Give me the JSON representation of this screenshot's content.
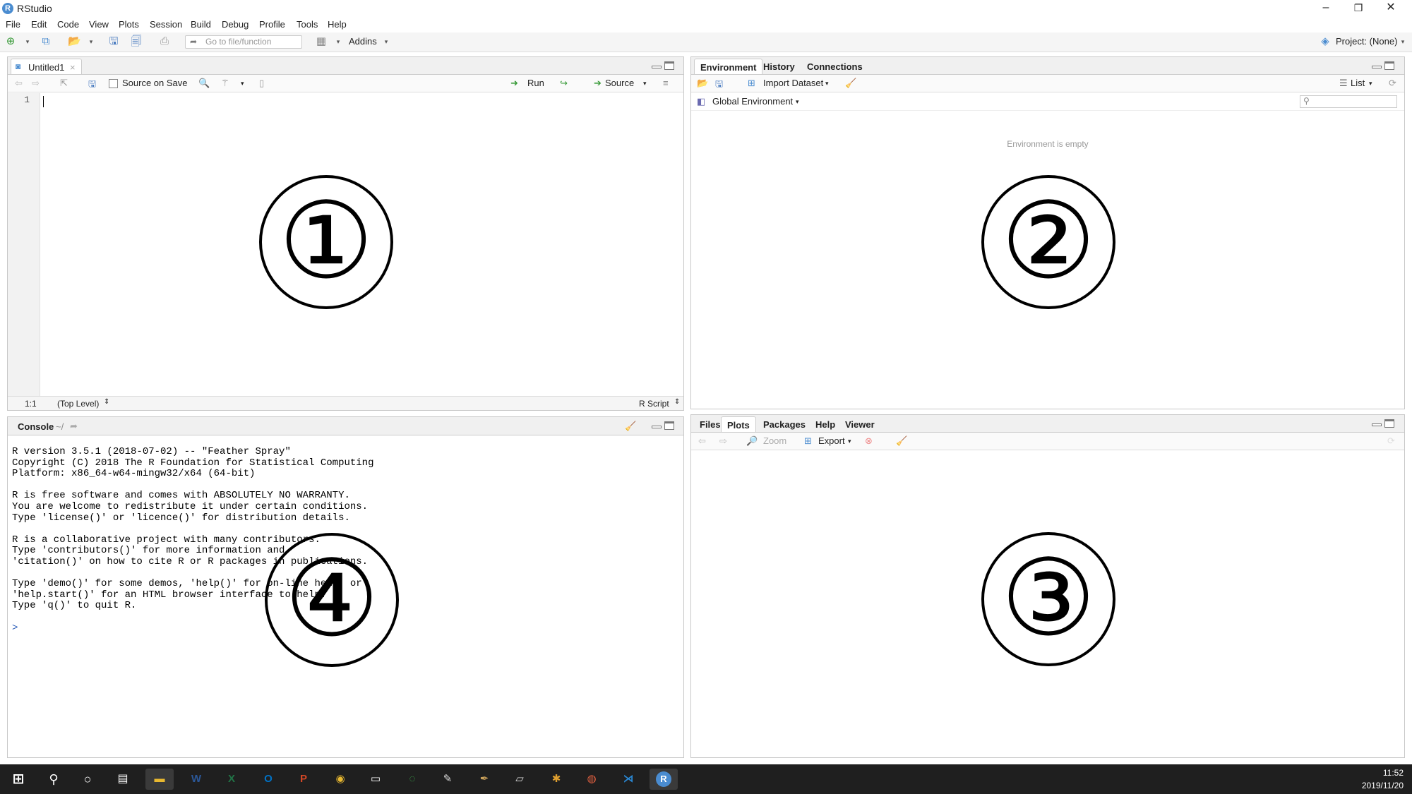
{
  "window": {
    "title": "RStudio",
    "minimize": "–",
    "restore": "❐",
    "close": "✕"
  },
  "menu": [
    "File",
    "Edit",
    "Code",
    "View",
    "Plots",
    "Session",
    "Build",
    "Debug",
    "Profile",
    "Tools",
    "Help"
  ],
  "toolbar": {
    "goto_placeholder": "Go to file/function",
    "addins": "Addins",
    "project": "Project: (None)"
  },
  "editor": {
    "tab": "Untitled1",
    "source_on_save": "Source on Save",
    "run": "Run",
    "source": "Source",
    "line_number": "1",
    "cursor_pos": "1:1",
    "scope": "(Top Level)",
    "file_type": "R Script"
  },
  "env": {
    "tabs": [
      "Environment",
      "History",
      "Connections"
    ],
    "import_dataset": "Import Dataset",
    "list_view": "List",
    "scope": "Global Environment",
    "empty": "Environment is empty"
  },
  "console": {
    "title": "Console",
    "path": "~/",
    "lines": [
      "R version 3.5.1 (2018-07-02) -- \"Feather Spray\"",
      "Copyright (C) 2018 The R Foundation for Statistical Computing",
      "Platform: x86_64-w64-mingw32/x64 (64-bit)",
      "",
      "R is free software and comes with ABSOLUTELY NO WARRANTY.",
      "You are welcome to redistribute it under certain conditions.",
      "Type 'license()' or 'licence()' for distribution details.",
      "",
      "R is a collaborative project with many contributors.",
      "Type 'contributors()' for more information and",
      "'citation()' on how to cite R or R packages in publications.",
      "",
      "Type 'demo()' for some demos, 'help()' for on-line help, or",
      "'help.start()' for an HTML browser interface to help.",
      "Type 'q()' to quit R.",
      "",
      "> "
    ]
  },
  "files": {
    "tabs": [
      "Files",
      "Plots",
      "Packages",
      "Help",
      "Viewer"
    ],
    "zoom": "Zoom",
    "export": "Export"
  },
  "annotations": [
    "①",
    "②",
    "③",
    "④"
  ],
  "taskbar": {
    "time": "11:52",
    "date": "2019/11/20"
  },
  "colors": {
    "accent": "#4a8cd0",
    "taskbar": "#1f1f1f",
    "run_green": "#3a9b3a"
  }
}
